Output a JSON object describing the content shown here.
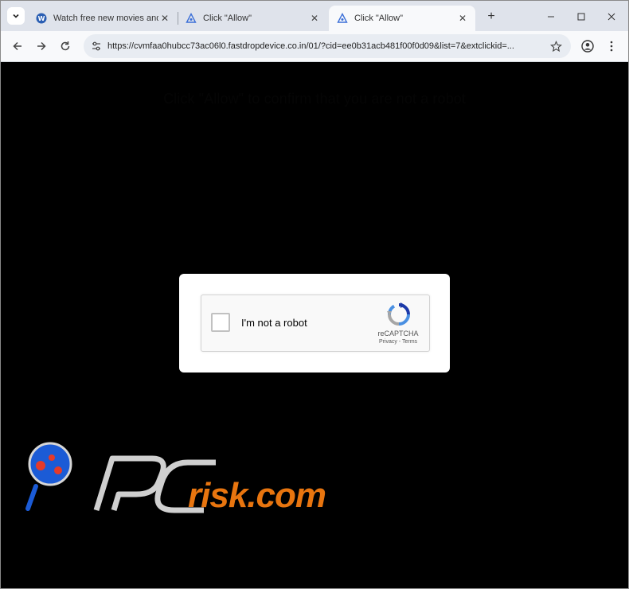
{
  "browser": {
    "tabs": [
      {
        "title": "Watch free new movies and T",
        "active": false
      },
      {
        "title": "Click \"Allow\"",
        "active": false
      },
      {
        "title": "Click \"Allow\"",
        "active": true
      }
    ],
    "url": "https://cvmfaa0hubcc73ac06l0.fastdropdevice.co.in/01/?cid=ee0b31acb481f00f0d09&list=7&extclickid=..."
  },
  "page": {
    "headline": "Click \"Allow\" to confirm that you are not a robot",
    "captcha": {
      "label": "I'm not a robot",
      "brand": "reCAPTCHA",
      "privacy": "Privacy",
      "separator": " - ",
      "terms": "Terms"
    }
  },
  "watermark": {
    "text": "risk.com"
  },
  "colors": {
    "tabstrip": "#dfe3eb",
    "toolbar": "#f8f9fb",
    "omnibox": "#e8ecf2",
    "page_bg": "#000000",
    "watermark_orange": "#e8750f",
    "recaptcha_blue": "#1c3aa9"
  }
}
